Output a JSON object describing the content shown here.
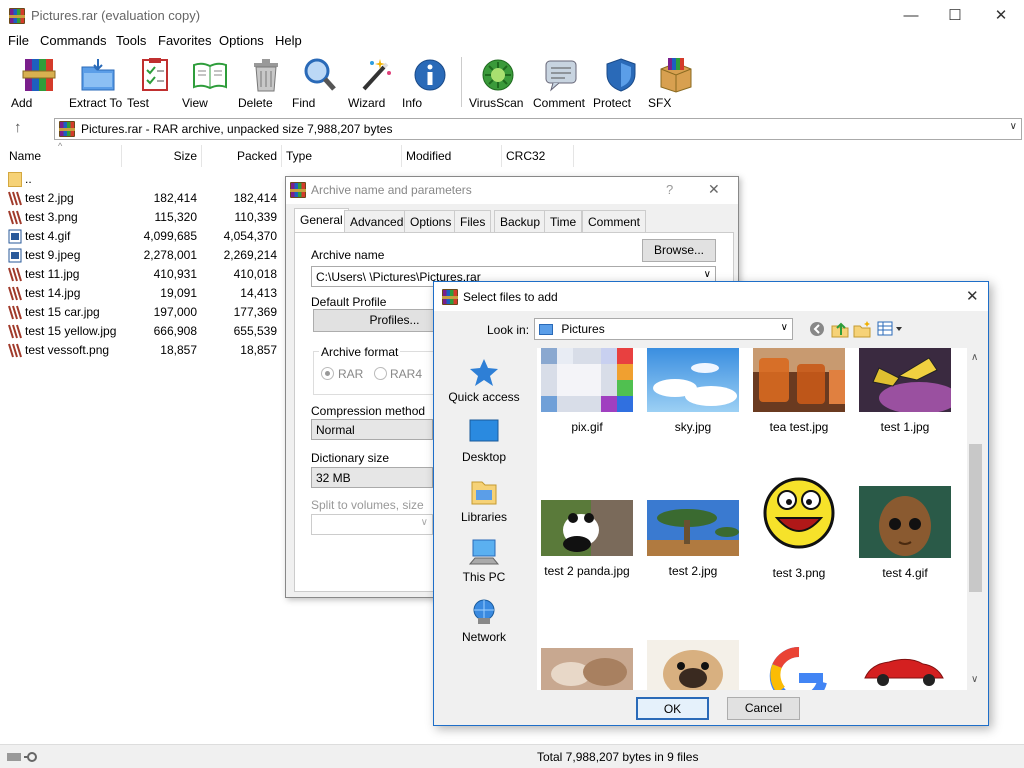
{
  "window": {
    "title": "Pictures.rar (evaluation copy)",
    "minimize": "—",
    "maximize": "☐",
    "close": "✕"
  },
  "menu": [
    "File",
    "Commands",
    "Tools",
    "Favorites",
    "Options",
    "Help"
  ],
  "toolbar": [
    "Add",
    "Extract To",
    "Test",
    "View",
    "Delete",
    "Find",
    "Wizard",
    "Info",
    "VirusScan",
    "Comment",
    "Protect",
    "SFX"
  ],
  "address": {
    "up_icon": "↑",
    "text": "Pictures.rar - RAR archive, unpacked size 7,988,207 bytes"
  },
  "list": {
    "columns": [
      "Name",
      "Size",
      "Packed",
      "Type",
      "Modified",
      "CRC32"
    ],
    "rows": [
      {
        "name": "..",
        "size": "",
        "packed": ""
      },
      {
        "name": "test 2.jpg",
        "size": "182,414",
        "packed": "182,414"
      },
      {
        "name": "test 3.png",
        "size": "115,320",
        "packed": "110,339"
      },
      {
        "name": "test 4.gif",
        "size": "4,099,685",
        "packed": "4,054,370"
      },
      {
        "name": "test 9.jpeg",
        "size": "2,278,001",
        "packed": "2,269,214"
      },
      {
        "name": "test 11.jpg",
        "size": "410,931",
        "packed": "410,018"
      },
      {
        "name": "test 14.jpg",
        "size": "19,091",
        "packed": "14,413"
      },
      {
        "name": "test 15 car.jpg",
        "size": "197,000",
        "packed": "177,369"
      },
      {
        "name": "test 15 yellow.jpg",
        "size": "666,908",
        "packed": "655,539"
      },
      {
        "name": "test vessoft.png",
        "size": "18,857",
        "packed": "18,857"
      }
    ]
  },
  "status": {
    "text": "Total 7,988,207 bytes in 9 files"
  },
  "archive_dialog": {
    "title": "Archive name and parameters",
    "help": "?",
    "close": "✕",
    "tabs": [
      "General",
      "Advanced",
      "Options",
      "Files",
      "Backup",
      "Time",
      "Comment"
    ],
    "archive_name_label": "Archive name",
    "browse": "Browse...",
    "archive_name_value": "C:\\Users\\        \\Pictures\\Pictures.rar",
    "default_profile_label": "Default Profile",
    "profiles": "Profiles...",
    "archive_format_label": "Archive format",
    "formats": [
      "RAR",
      "RAR4"
    ],
    "compression_label": "Compression method",
    "compression_value": "Normal",
    "dictionary_label": "Dictionary size",
    "dictionary_value": "32 MB",
    "split_label": "Split to volumes, size"
  },
  "select_dialog": {
    "title": "Select files to add",
    "close": "✕",
    "look_in_label": "Look in:",
    "look_in_value": "Pictures",
    "places": [
      "Quick access",
      "Desktop",
      "Libraries",
      "This PC",
      "Network"
    ],
    "files": [
      "pix.gif",
      "sky.jpg",
      "tea test.jpg",
      "test 1.jpg",
      "test 2 panda.jpg",
      "test 2.jpg",
      "test 3.png",
      "test 4.gif",
      "",
      "",
      "",
      ""
    ],
    "ok": "OK",
    "cancel": "Cancel"
  }
}
